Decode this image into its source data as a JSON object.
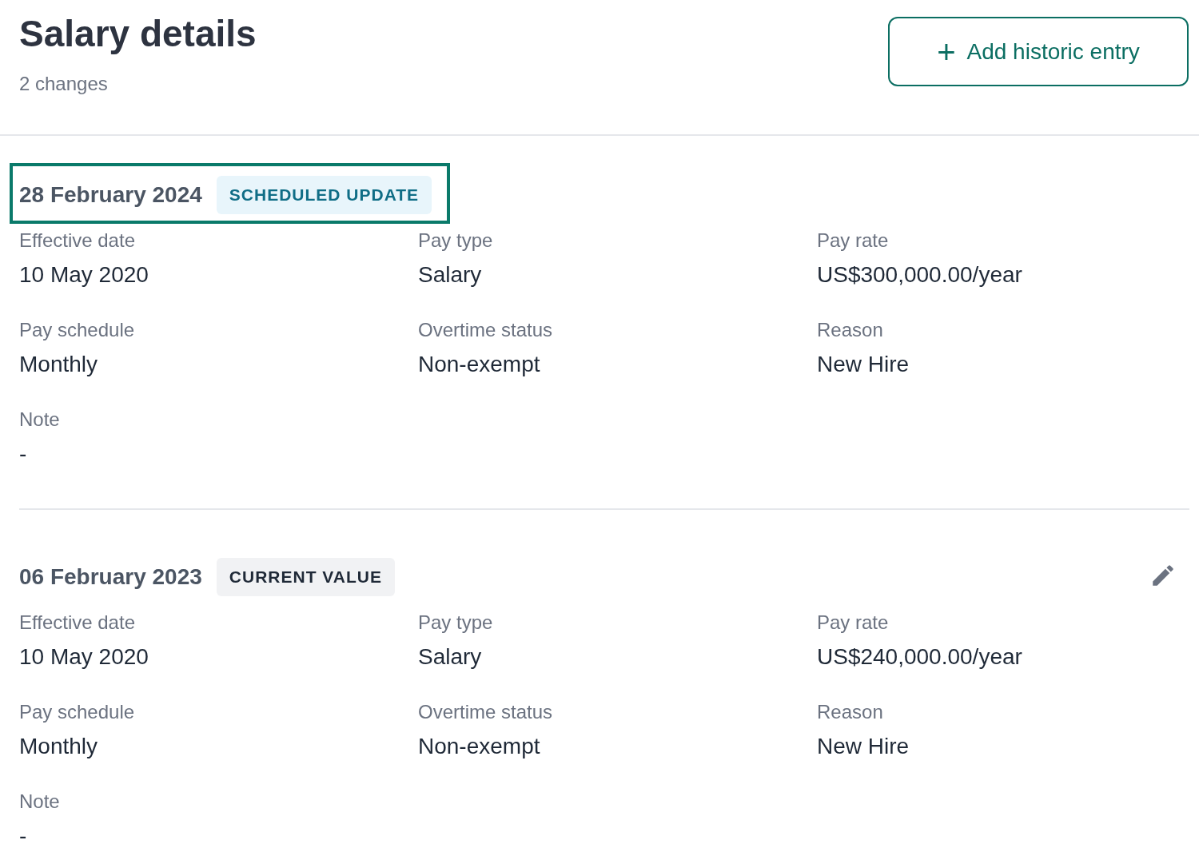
{
  "header": {
    "title": "Salary details",
    "subtitle": "2 changes",
    "add_button": {
      "icon": "+",
      "label": "Add historic entry"
    }
  },
  "entries": [
    {
      "date": "28 February 2024",
      "badge": {
        "kind": "scheduled",
        "label": "SCHEDULED UPDATE"
      },
      "highlighted": true,
      "editable": false,
      "fields": [
        {
          "label": "Effective date",
          "value": "10 May 2020"
        },
        {
          "label": "Pay type",
          "value": "Salary"
        },
        {
          "label": "Pay rate",
          "value": "US$300,000.00/year"
        },
        {
          "label": "Pay schedule",
          "value": "Monthly"
        },
        {
          "label": "Overtime status",
          "value": "Non-exempt"
        },
        {
          "label": "Reason",
          "value": "New Hire"
        },
        {
          "label": "Note",
          "value": "-"
        }
      ]
    },
    {
      "date": "06 February 2023",
      "badge": {
        "kind": "current",
        "label": "CURRENT VALUE"
      },
      "highlighted": false,
      "editable": true,
      "fields": [
        {
          "label": "Effective date",
          "value": "10 May 2020"
        },
        {
          "label": "Pay type",
          "value": "Salary"
        },
        {
          "label": "Pay rate",
          "value": "US$240,000.00/year"
        },
        {
          "label": "Pay schedule",
          "value": "Monthly"
        },
        {
          "label": "Overtime status",
          "value": "Non-exempt"
        },
        {
          "label": "Reason",
          "value": "New Hire"
        },
        {
          "label": "Note",
          "value": "-"
        }
      ]
    }
  ]
}
